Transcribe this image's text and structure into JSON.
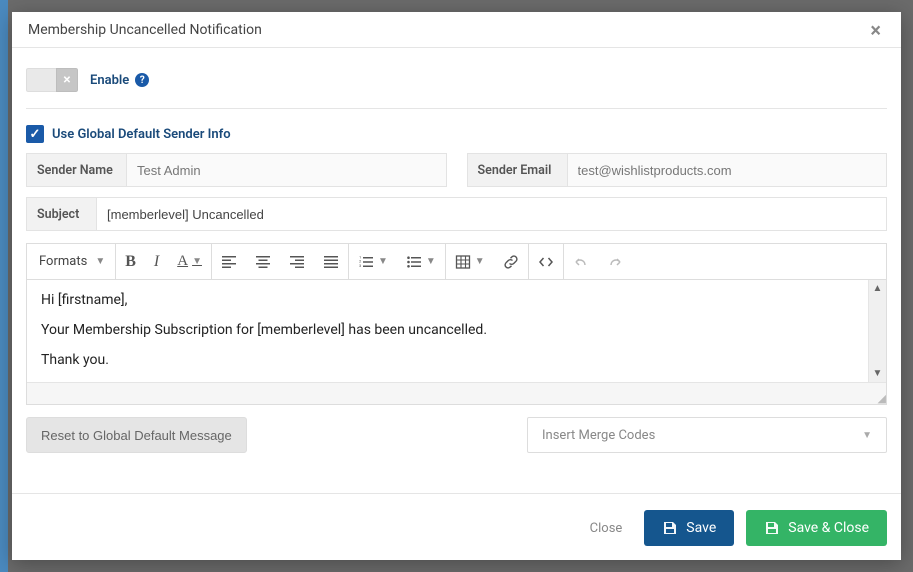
{
  "modal": {
    "title": "Membership Uncancelled Notification"
  },
  "enable": {
    "label": "Enable"
  },
  "global_sender": {
    "label": "Use Global Default Sender Info",
    "checked": true
  },
  "sender_name": {
    "label": "Sender Name",
    "value": "Test Admin"
  },
  "sender_email": {
    "label": "Sender Email",
    "value": "test@wishlistproducts.com"
  },
  "subject": {
    "label": "Subject",
    "value": "[memberlevel] Uncancelled"
  },
  "toolbar": {
    "formats": "Formats"
  },
  "body": {
    "line1": "Hi [firstname],",
    "line2": "Your Membership Subscription for [memberlevel] has been uncancelled.",
    "line3": "Thank you."
  },
  "actions": {
    "reset": "Reset to Global Default Message",
    "merge_placeholder": "Insert Merge Codes",
    "close": "Close",
    "save": "Save",
    "save_close": "Save & Close"
  }
}
